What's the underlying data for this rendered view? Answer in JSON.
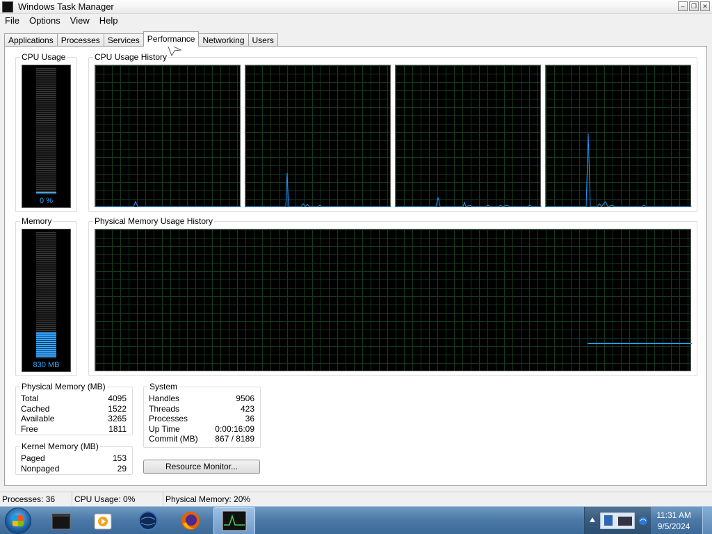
{
  "window": {
    "title": "Windows Task Manager"
  },
  "menu": [
    "File",
    "Options",
    "View",
    "Help"
  ],
  "tabs": [
    "Applications",
    "Processes",
    "Services",
    "Performance",
    "Networking",
    "Users"
  ],
  "active_tab": "Performance",
  "cpu_usage": {
    "label": "CPU Usage",
    "value": "0 %",
    "fraction": 0.0
  },
  "cpu_history": {
    "label": "CPU Usage History",
    "cores": 4
  },
  "memory": {
    "label": "Memory",
    "value": "830 MB",
    "fraction": 0.2
  },
  "memory_history": {
    "label": "Physical Memory Usage History"
  },
  "physical_memory": {
    "label": "Physical Memory (MB)",
    "rows": [
      {
        "name": "Total",
        "value": "4095"
      },
      {
        "name": "Cached",
        "value": "1522"
      },
      {
        "name": "Available",
        "value": "3265"
      },
      {
        "name": "Free",
        "value": "1811"
      }
    ]
  },
  "kernel_memory": {
    "label": "Kernel Memory (MB)",
    "rows": [
      {
        "name": "Paged",
        "value": "153"
      },
      {
        "name": "Nonpaged",
        "value": "29"
      }
    ]
  },
  "system": {
    "label": "System",
    "rows": [
      {
        "name": "Handles",
        "value": "9506"
      },
      {
        "name": "Threads",
        "value": "423"
      },
      {
        "name": "Processes",
        "value": "36"
      },
      {
        "name": "Up Time",
        "value": "0:00:16:09"
      },
      {
        "name": "Commit (MB)",
        "value": "867 / 8189"
      }
    ]
  },
  "resource_monitor_button": "Resource Monitor...",
  "status": {
    "processes": "Processes: 36",
    "cpu": "CPU Usage: 0%",
    "memory": "Physical Memory: 20%"
  },
  "clock": {
    "time": "11:31 AM",
    "date": "9/5/2024"
  },
  "colors": {
    "graph_line": "#1e9bff",
    "grid": "#143a1e",
    "taskbar": "#4d7aa8"
  },
  "icons": [
    "windows-start-orb",
    "terminal-icon",
    "media-player-icon",
    "globe-icon",
    "firefox-icon",
    "task-manager-icon"
  ]
}
